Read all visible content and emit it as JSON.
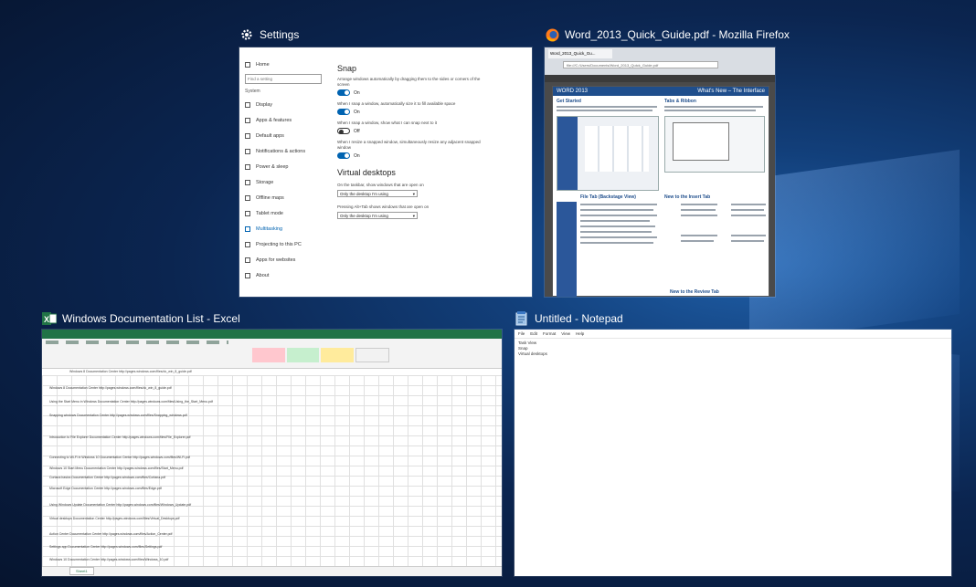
{
  "desktop": {
    "accent": "#0b2550"
  },
  "settings": {
    "title": "Settings",
    "home": "Home",
    "search_placeholder": "Find a setting",
    "group": "System",
    "nav": [
      "Display",
      "Apps & features",
      "Default apps",
      "Notifications & actions",
      "Power & sleep",
      "Storage",
      "Offline maps",
      "Tablet mode",
      "Multitasking",
      "Projecting to this PC",
      "Apps for websites",
      "About"
    ],
    "active_nav": "Multitasking",
    "snap_heading": "Snap",
    "snap_options": [
      {
        "desc": "Arrange windows automatically by dragging them to the sides or corners of the screen",
        "state": "On"
      },
      {
        "desc": "When I snap a window, automatically size it to fill available space",
        "state": "On"
      },
      {
        "desc": "When I snap a window, show what I can snap next to it",
        "state": "Off"
      },
      {
        "desc": "When I resize a snapped window, simultaneously resize any adjacent snapped window",
        "state": "On"
      }
    ],
    "vd_heading": "Virtual desktops",
    "vd1_label": "On the taskbar, show windows that are open on",
    "vd1_value": "Only the desktop I'm using",
    "vd2_label": "Pressing Alt+Tab shows windows that are open on",
    "vd2_value": "Only the desktop I'm using"
  },
  "firefox": {
    "title": "Word_2013_Quick_Guide.pdf - Mozilla Firefox",
    "tab_label": "Word_2013_Quick_Gu...",
    "url": "file:///C:/Users/Documents/Word_2013_Quick_Guide.pdf",
    "pdf_left_head": "WORD 2013",
    "pdf_right_head": "What's New – The Interface",
    "sections": [
      "File Tab (Backstage View)",
      "New to the Insert Tab",
      "New to the Review Tab",
      "Get Started",
      "Tabs & Ribbon"
    ]
  },
  "excel": {
    "title": "Windows Documentation List - Excel",
    "sheet_tab": "Sheet1",
    "rows": [
      "Windows 8    Documentation Center    http://pages.windows.com/files/dc_win_8_guide.pdf",
      "Using the Start Menu in Windows    Documentation Center    http://pages.windows.com/files/Using_the_Start_Menu.pdf",
      "Snapping windows    Documentation Center    http://pages.windows.com/files/Snapping_windows.pdf",
      "Introduction to File Explorer    Documentation Center    http://pages.windows.com/files/File_Explorer.pdf",
      "Connecting to Wi-Fi in Windows 10    Documentation Center    http://pages.windows.com/files/Wi-Fi.pdf",
      "Windows 10 Start Menu    Documentation Center    http://pages.windows.com/files/Start_Menu.pdf",
      "Cortana basics    Documentation Center    http://pages.windows.com/files/Cortana.pdf",
      "Microsoft Edge    Documentation Center    http://pages.windows.com/files/Edge.pdf",
      "Using Windows Update    Documentation Center    http://pages.windows.com/files/Windows_Update.pdf",
      "Virtual desktops    Documentation Center    http://pages.windows.com/files/Virtual_Desktops.pdf",
      "Action Center    Documentation Center    http://pages.windows.com/files/Action_Center.pdf",
      "Settings app    Documentation Center    http://pages.windows.com/files/Settings.pdf",
      "Windows 10    Documentation Center    http://pages.windows.com/files/Windows_10.pdf"
    ]
  },
  "notepad": {
    "title": "Untitled - Notepad",
    "menu": [
      "File",
      "Edit",
      "Format",
      "View",
      "Help"
    ],
    "lines": [
      "Task View",
      "Snap",
      "Virtual desktops"
    ]
  }
}
